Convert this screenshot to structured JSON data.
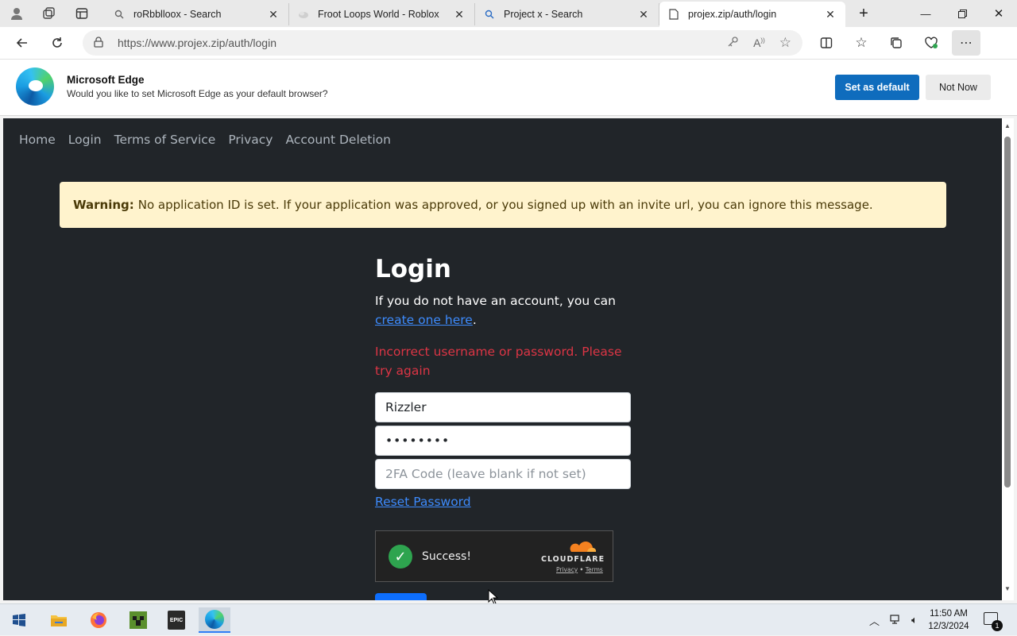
{
  "browser": {
    "tabs": [
      {
        "title": "roRbblloox - Search",
        "icon": "search-icon"
      },
      {
        "title": "Froot Loops World - Roblox",
        "icon": "roblox-icon"
      },
      {
        "title": "Project x - Search",
        "icon": "search-icon"
      },
      {
        "title": "projex.zip/auth/login",
        "icon": "page-icon"
      }
    ],
    "address": "https://www.projex.zip/auth/login"
  },
  "banner": {
    "title": "Microsoft Edge",
    "subtitle": "Would you like to set Microsoft Edge as your default browser?",
    "primary_label": "Set as default",
    "secondary_label": "Not Now"
  },
  "site": {
    "nav": [
      "Home",
      "Login",
      "Terms of Service",
      "Privacy",
      "Account Deletion"
    ],
    "warning_label": "Warning:",
    "warning_text": "No application ID is set. If your application was approved, or you signed up with an invite url, you can ignore this message.",
    "heading": "Login",
    "intro_prefix": "If you do not have an account, you can ",
    "intro_link": "create one here",
    "intro_suffix": ".",
    "error": "Incorrect username or password. Please try again",
    "username_value": "Rizzler",
    "password_value": "••••••••",
    "twofa_placeholder": "2FA Code (leave blank if not set)",
    "reset_link": "Reset Password",
    "captcha": {
      "status": "Success!",
      "brand": "CLOUDFLARE",
      "privacy": "Privacy",
      "separator": "•",
      "terms": "Terms"
    }
  },
  "taskbar": {
    "time": "11:50 AM",
    "date": "12/3/2024",
    "notification_count": "1",
    "epic_label": "EPIC"
  },
  "colors": {
    "page_bg": "#212529",
    "link": "#3d8bfd",
    "error": "#dc3545",
    "warning_bg": "#fff3cd",
    "edge_blue": "#0f6cbd"
  }
}
